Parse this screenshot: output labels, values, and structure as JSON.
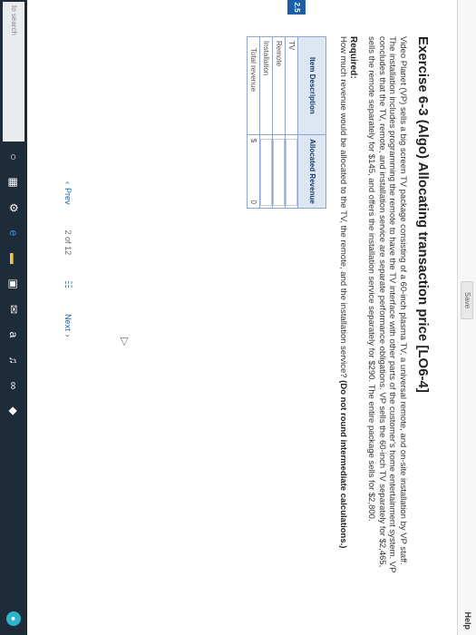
{
  "header": {
    "save_label": "Save",
    "help_label": "Help",
    "side_tag": "2.5"
  },
  "exercise": {
    "title": "Exercise 6-3 (Algo) Allocating transaction price [LO6-4]",
    "body": "Video Planet (VP) sells a big screen TV package consisting of a 60-inch plasma TV, a universal remote, and on-site installation by VP staff. The installation includes programming the remote to have the TV interface with other parts of the customer's home entertainment system. VP concludes that the TV, remote, and installation service are separate performance obligations. VP sells the 60-inch TV separately for $2,465, sells the remote separately for $145, and offers the installation service separately for $290. The entire package sells for $2,800.",
    "required_label": "Required:",
    "question": "How much revenue would be allocated to the TV, the remote, and the installation service?",
    "question_emphasis": "(Do not round intermediate calculations.)"
  },
  "table": {
    "header_desc": "Item Description",
    "header_value": "Allocated Revenue",
    "rows": [
      {
        "label": "TV"
      },
      {
        "label": "Remote"
      },
      {
        "label": "Installation"
      }
    ],
    "total_label": "Total revenue",
    "total_currency": "$",
    "total_value": "0"
  },
  "pager": {
    "prev_label": "Prev",
    "page_current": "2",
    "page_of": "of",
    "page_total": "12",
    "next_label": "Next"
  },
  "taskbar": {
    "search_placeholder": "to search"
  }
}
